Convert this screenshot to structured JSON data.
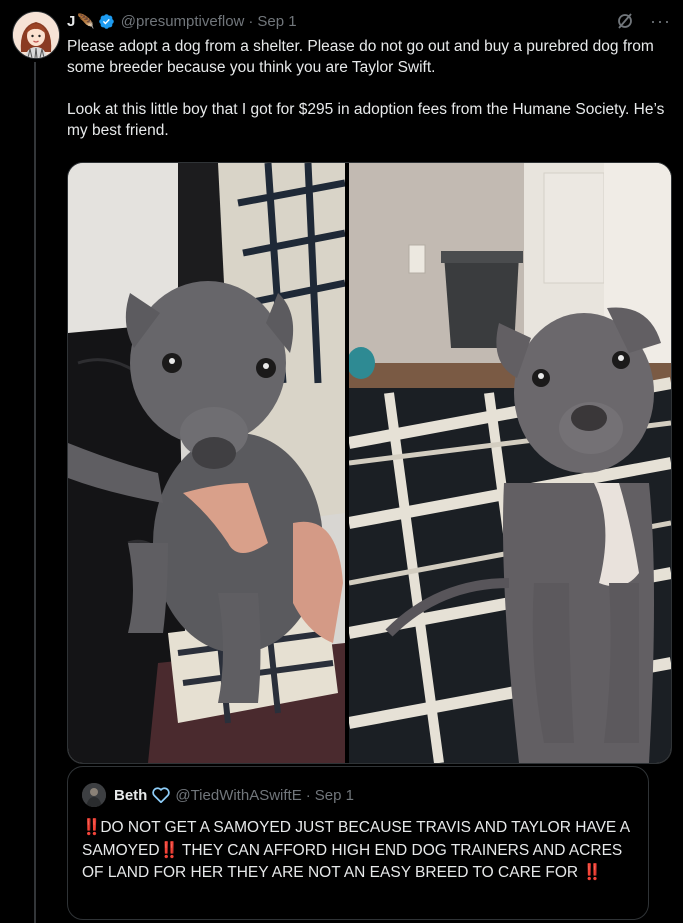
{
  "tweet": {
    "name": "J",
    "name_emoji": "🪶",
    "handle": "@presumptiveflow",
    "separator": "·",
    "date": "Sep 1",
    "more": "···",
    "paragraph_1": "Please adopt a dog from a shelter.  Please do not go out and buy a purebred dog from some breeder because you think you are Taylor Swift.",
    "paragraph_2": "Look at this little boy that I got for $295 in adoption fees from the Humane Society. He’s my best friend.",
    "photos": [
      {
        "icon": "puppy-on-lap-photo"
      },
      {
        "icon": "puppy-on-blanket-photo"
      }
    ]
  },
  "quote": {
    "name": "Beth",
    "handle": "@TiedWithASwiftE",
    "separator": "·",
    "date": "Sep 1",
    "bang": "‼️",
    "text_1": "DO NOT GET A SAMOYED JUST BECAUSE TRAVIS AND TAYLOR HAVE A SAMOYED",
    "text_2": " THEY CAN AFFORD HIGH END DOG TRAINERS AND ACRES OF LAND FOR HER THEY ARE NOT AN EASY BREED TO CARE FOR "
  },
  "colors": {
    "background": "#000000",
    "text": "#e7e9ea",
    "muted": "#71767b",
    "verified": "#1d9bf0",
    "heart": "#8ecdf8",
    "border": "#2f3336"
  }
}
